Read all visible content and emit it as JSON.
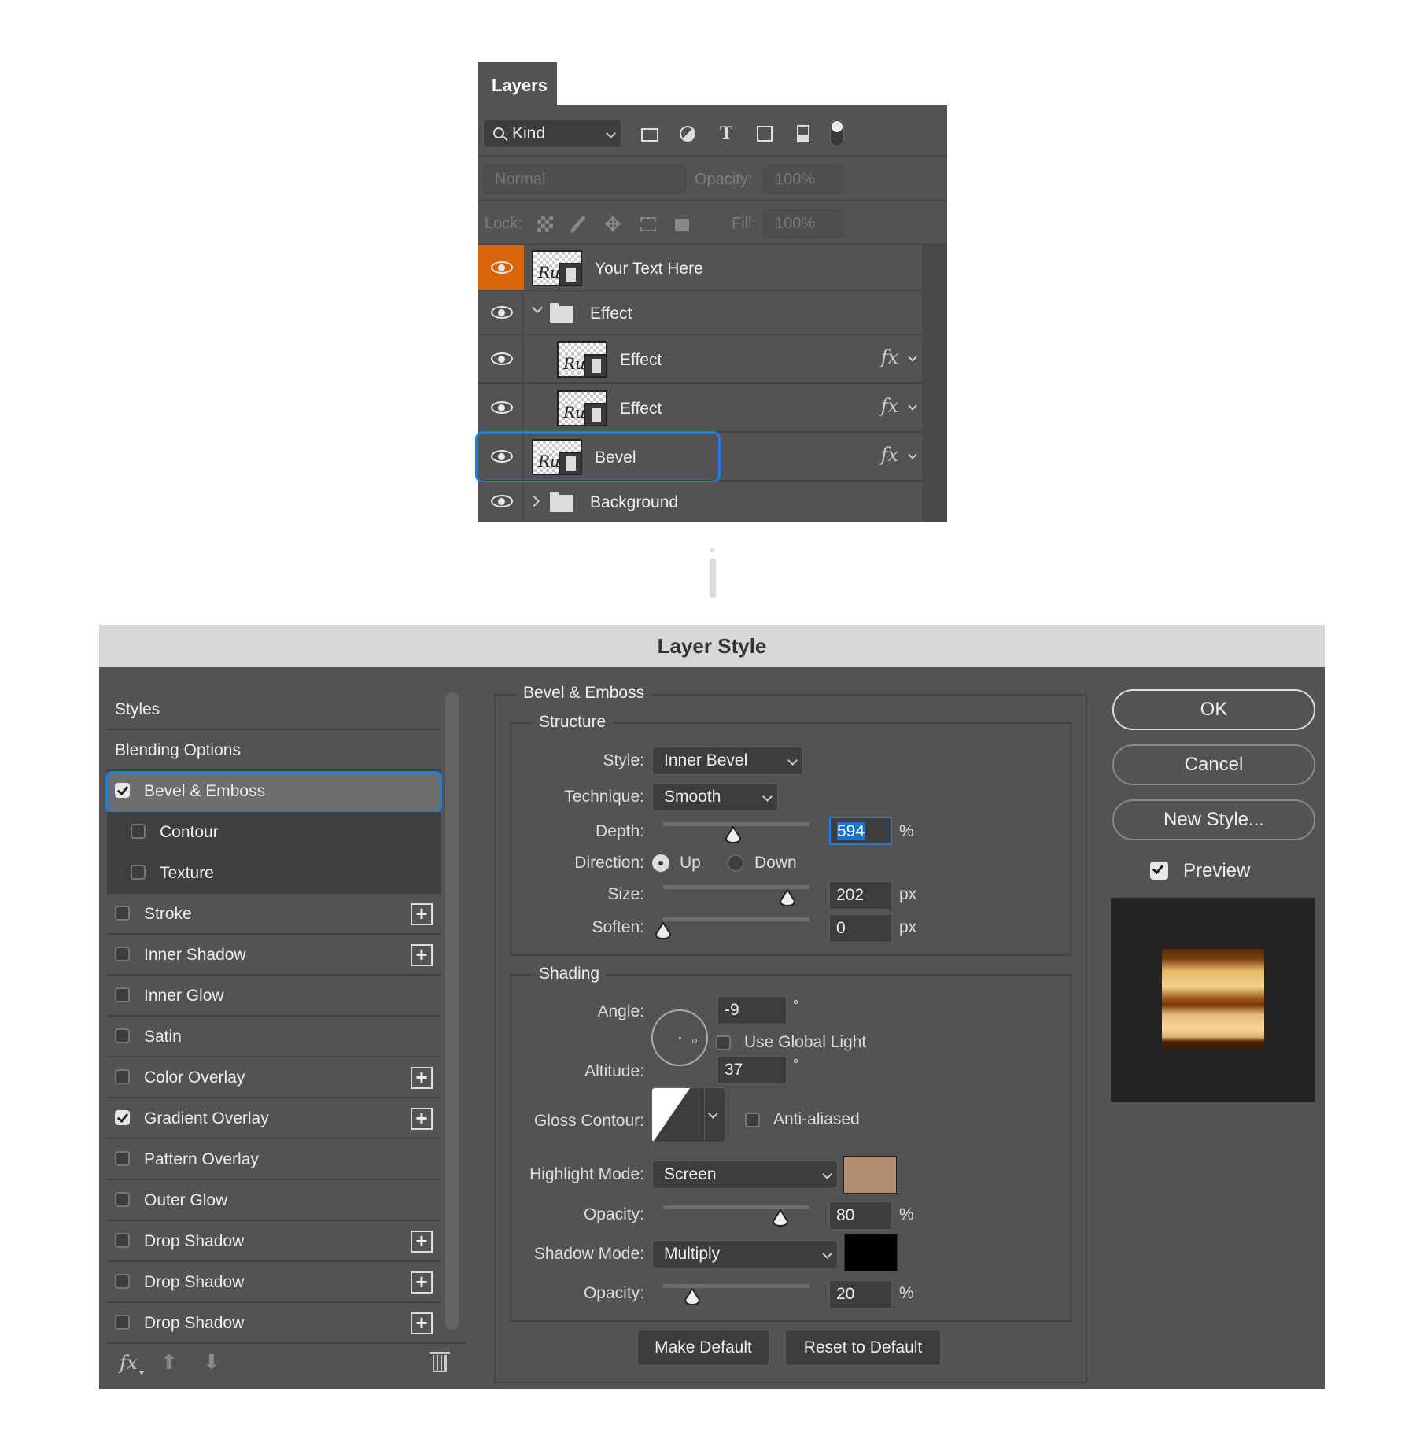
{
  "layers_panel": {
    "tab_label": "Layers",
    "filter": {
      "icon": "search-icon",
      "value": "Kind"
    },
    "filter_icons": [
      "image-filter-icon",
      "adjustment-filter-icon",
      "type-filter-icon",
      "shape-filter-icon",
      "smart-object-filter-icon",
      "filter-toggle-icon"
    ],
    "blend_mode": "Normal",
    "opacity_label": "Opacity:",
    "opacity_value": "100%",
    "lock_label": "Lock:",
    "fill_label": "Fill:",
    "fill_value": "100%",
    "layers": [
      {
        "name": "Your Text Here",
        "type": "smart-object",
        "visible": true,
        "active_eye": true,
        "fx": false
      },
      {
        "name": "Effect",
        "type": "group",
        "expanded": true,
        "visible": true,
        "fx": false
      },
      {
        "name": "Effect",
        "type": "smart-object",
        "visible": true,
        "fx": true,
        "indent": true
      },
      {
        "name": "Effect",
        "type": "smart-object",
        "visible": true,
        "fx": true,
        "indent": true
      },
      {
        "name": "Bevel",
        "type": "smart-object",
        "visible": true,
        "fx": true,
        "highlighted": true
      },
      {
        "name": "Background",
        "type": "group",
        "expanded": false,
        "visible": true,
        "fx": false
      }
    ],
    "fx_label": "fx"
  },
  "dialog": {
    "title": "Layer Style",
    "style_list": [
      {
        "label": "Styles",
        "checkbox": false
      },
      {
        "label": "Blending Options",
        "checkbox": false
      },
      {
        "label": "Bevel & Emboss",
        "checkbox": true,
        "checked": true,
        "selected": true
      },
      {
        "label": "Contour",
        "checkbox": true,
        "checked": false,
        "sub": true
      },
      {
        "label": "Texture",
        "checkbox": true,
        "checked": false,
        "sub": true
      },
      {
        "label": "Stroke",
        "checkbox": true,
        "checked": false,
        "plus": true
      },
      {
        "label": "Inner Shadow",
        "checkbox": true,
        "checked": false,
        "plus": true
      },
      {
        "label": "Inner Glow",
        "checkbox": true,
        "checked": false
      },
      {
        "label": "Satin",
        "checkbox": true,
        "checked": false
      },
      {
        "label": "Color Overlay",
        "checkbox": true,
        "checked": false,
        "plus": true
      },
      {
        "label": "Gradient Overlay",
        "checkbox": true,
        "checked": true,
        "plus": true
      },
      {
        "label": "Pattern Overlay",
        "checkbox": true,
        "checked": false
      },
      {
        "label": "Outer Glow",
        "checkbox": true,
        "checked": false
      },
      {
        "label": "Drop Shadow",
        "checkbox": true,
        "checked": false,
        "plus": true
      },
      {
        "label": "Drop Shadow",
        "checkbox": true,
        "checked": false,
        "plus": true
      },
      {
        "label": "Drop Shadow",
        "checkbox": true,
        "checked": false,
        "plus": true
      }
    ],
    "footer": {
      "fx": "fx"
    },
    "bevel": {
      "section_title": "Bevel & Emboss",
      "structure": {
        "title": "Structure",
        "style_label": "Style:",
        "style_value": "Inner Bevel",
        "technique_label": "Technique:",
        "technique_value": "Smooth",
        "depth_label": "Depth:",
        "depth_value": "594",
        "depth_unit": "%",
        "depth_slider": 0.48,
        "direction_label": "Direction:",
        "direction_up": "Up",
        "direction_down": "Down",
        "direction_selected": "Up",
        "size_label": "Size:",
        "size_value": "202",
        "size_unit": "px",
        "size_slider": 0.85,
        "soften_label": "Soften:",
        "soften_value": "0",
        "soften_unit": "px",
        "soften_slider": 0
      },
      "shading": {
        "title": "Shading",
        "angle_label": "Angle:",
        "angle_value": "-9",
        "degree": "°",
        "global_light_label": "Use Global Light",
        "global_light_checked": false,
        "altitude_label": "Altitude:",
        "altitude_value": "37",
        "gloss_label": "Gloss Contour:",
        "anti_aliased_label": "Anti-aliased",
        "anti_aliased_checked": false,
        "highlight_label": "Highlight Mode:",
        "highlight_value": "Screen",
        "highlight_color": "#b18e70",
        "highlight_opacity_label": "Opacity:",
        "highlight_opacity_value": "80",
        "highlight_opacity_slider": 0.8,
        "shadow_label": "Shadow Mode:",
        "shadow_value": "Multiply",
        "shadow_color": "#000000",
        "shadow_opacity_label": "Opacity:",
        "shadow_opacity_value": "20",
        "shadow_opacity_slider": 0.2,
        "pct": "%"
      },
      "make_default": "Make Default",
      "reset_default": "Reset to Default"
    },
    "buttons": {
      "ok": "OK",
      "cancel": "Cancel",
      "new_style": "New Style..."
    },
    "preview_label": "Preview",
    "preview_checked": true
  }
}
